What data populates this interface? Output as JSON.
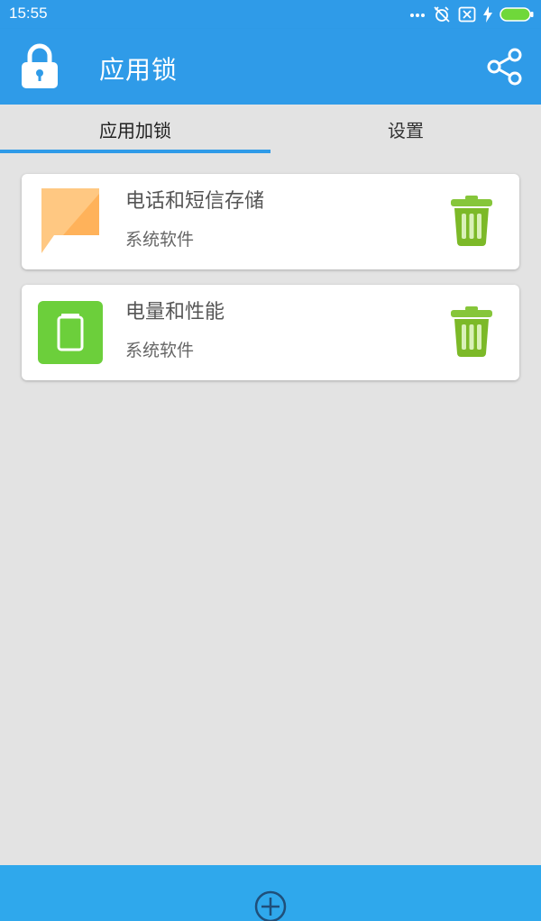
{
  "status_bar": {
    "time": "15:55",
    "icons": [
      "more-dots-icon",
      "alarm-off-icon",
      "sim-off-icon",
      "charging-icon",
      "battery-icon"
    ]
  },
  "app_bar": {
    "title": "应用锁",
    "logo_icon": "padlock-icon",
    "share_icon": "share-icon"
  },
  "tabs": [
    {
      "label": "应用加锁",
      "active": true
    },
    {
      "label": "设置",
      "active": false
    }
  ],
  "locked_apps": [
    {
      "name": "电话和短信存储",
      "category": "系统软件",
      "icon": "message-bubble-icon",
      "icon_color": "#ffb35c"
    },
    {
      "name": "电量和性能",
      "category": "系统软件",
      "icon": "battery-app-icon",
      "icon_color": "#6ccf3b"
    }
  ],
  "bottom_bar": {
    "add_icon": "add-circle-icon"
  },
  "colors": {
    "primary": "#2f9be8",
    "background": "#e3e3e3",
    "trash_green": "#7fbf1e"
  }
}
